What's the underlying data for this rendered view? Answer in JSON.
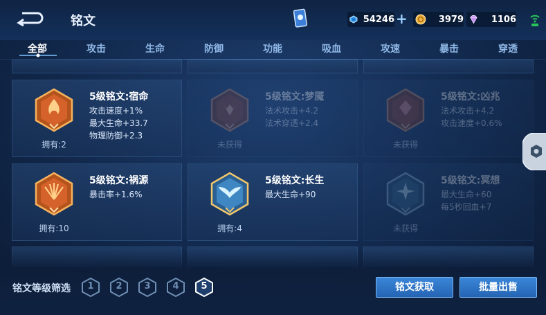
{
  "header": {
    "title": "铭文",
    "currencies": [
      {
        "icon": "blue-crystal-icon",
        "value": "54246"
      },
      {
        "icon": "gold-coin-icon",
        "value": "3979"
      },
      {
        "icon": "purple-gem-icon",
        "value": "1106"
      }
    ]
  },
  "tabs": [
    {
      "label": "全部"
    },
    {
      "label": "攻击"
    },
    {
      "label": "生命"
    },
    {
      "label": "防御"
    },
    {
      "label": "功能"
    },
    {
      "label": "吸血"
    },
    {
      "label": "攻速"
    },
    {
      "label": "暴击"
    },
    {
      "label": "穿透"
    }
  ],
  "cards": [
    {
      "name": "5级铭文:宿命",
      "stats": [
        "攻击速度+1%",
        "最大生命+33.7",
        "物理防御+2.3"
      ],
      "owned": "拥有:2",
      "icon": "red-flame-emblem-icon"
    },
    {
      "name": "5级铭文:梦魇",
      "stats": [
        "法术攻击+4.2",
        "法术穿透+2.4"
      ],
      "owned": "未获得",
      "icon": "red-claw-emblem-icon"
    },
    {
      "name": "5级铭文:凶兆",
      "stats": [
        "法术攻击+4.2",
        "攻击速度+0.6%"
      ],
      "owned": "未获得",
      "icon": "red-gem-emblem-icon"
    },
    {
      "name": "5级铭文:祸源",
      "stats": [
        "暴击率+1.6%"
      ],
      "owned": "拥有:10",
      "icon": "red-fan-emblem-icon"
    },
    {
      "name": "5级铭文:长生",
      "stats": [
        "最大生命+90"
      ],
      "owned": "拥有:4",
      "icon": "blue-wing-emblem-icon"
    },
    {
      "name": "5级铭文:冥想",
      "stats": [
        "最大生命+60",
        "每5秒回血+7"
      ],
      "owned": "未获得",
      "icon": "blue-star-emblem-icon"
    }
  ],
  "footer": {
    "filter_label": "铭文等级筛选",
    "levels": [
      "1",
      "2",
      "3",
      "4",
      "5"
    ],
    "selected_level": "5",
    "acquire_label": "铭文获取",
    "bulk_sell_label": "批量出售"
  },
  "colors": {
    "accent": "#2f76c8",
    "selected_level": "#ffffff",
    "unselected_level": "#6f8fb4"
  }
}
